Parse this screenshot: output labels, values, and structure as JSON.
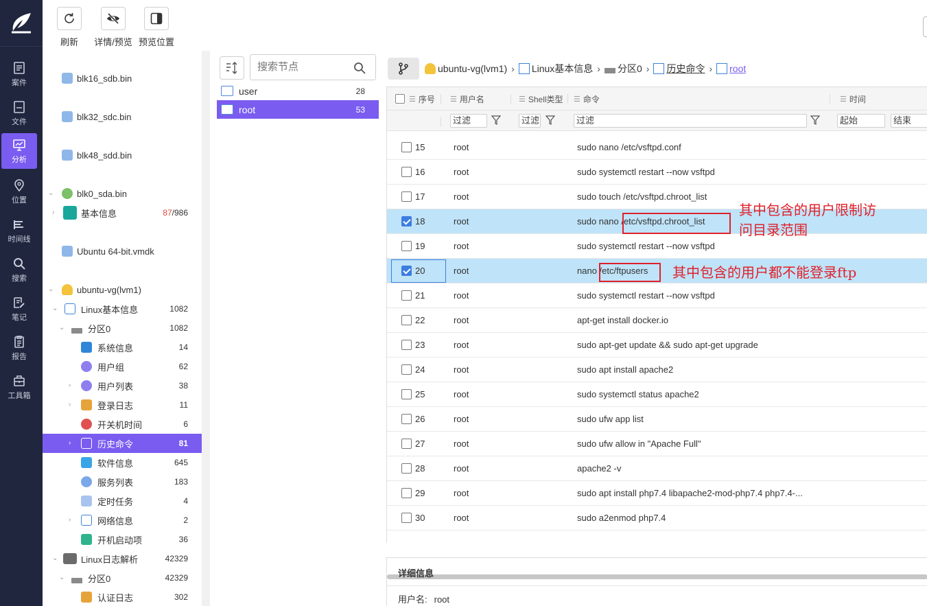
{
  "toolbar": {
    "refresh": "刷新",
    "detail_preview": "详情/预览",
    "preview_position": "预览位置"
  },
  "nav": {
    "items": [
      {
        "label": "案件",
        "icon": "case-icon"
      },
      {
        "label": "文件",
        "icon": "file-icon"
      },
      {
        "label": "分析",
        "icon": "analysis-icon",
        "active": true
      },
      {
        "label": "位置",
        "icon": "location-icon"
      },
      {
        "label": "时间线",
        "icon": "timeline-icon"
      },
      {
        "label": "搜索",
        "icon": "search-icon"
      },
      {
        "label": "笔记",
        "icon": "note-icon"
      },
      {
        "label": "报告",
        "icon": "report-icon"
      },
      {
        "label": "工具箱",
        "icon": "toolbox-icon"
      }
    ]
  },
  "tree": {
    "items": [
      {
        "label": "blk16_sdb.bin",
        "count": ""
      },
      {
        "label": "blk32_sdc.bin",
        "count": ""
      },
      {
        "label": "blk48_sdd.bin",
        "count": ""
      },
      {
        "label": "blk0_sda.bin",
        "count": ""
      },
      {
        "label": "基本信息",
        "count_red": "87",
        "count_rest": "/986"
      },
      {
        "label": "Ubuntu 64-bit.vmdk",
        "count": ""
      },
      {
        "label": "ubuntu-vg(lvm1)",
        "count": ""
      },
      {
        "label": "Linux基本信息",
        "count": "1082"
      },
      {
        "label": "分区0",
        "count": "1082"
      },
      {
        "label": "系统信息",
        "count": "14"
      },
      {
        "label": "用户组",
        "count": "62"
      },
      {
        "label": "用户列表",
        "count": "38"
      },
      {
        "label": "登录日志",
        "count": "11"
      },
      {
        "label": "开关机时间",
        "count": "6"
      },
      {
        "label": "历史命令",
        "count": "81"
      },
      {
        "label": "软件信息",
        "count": "645"
      },
      {
        "label": "服务列表",
        "count": "183"
      },
      {
        "label": "定时任务",
        "count": "4"
      },
      {
        "label": "网络信息",
        "count": "2"
      },
      {
        "label": "开机启动项",
        "count": "36"
      },
      {
        "label": "Linux日志解析",
        "count": "42329"
      },
      {
        "label": "分区0",
        "count": "42329"
      },
      {
        "label": "认证日志",
        "count": "302"
      }
    ]
  },
  "nodes": {
    "search_placeholder": "搜索节点",
    "items": [
      {
        "label": "user",
        "count": "28"
      },
      {
        "label": "root",
        "count": "53"
      }
    ]
  },
  "breadcrumb": {
    "items": [
      "ubuntu-vg(lvm1)",
      "Linux基本信息",
      "分区0",
      "历史命令",
      "root"
    ]
  },
  "table": {
    "headers": {
      "no": "序号",
      "user": "用户名",
      "shell": "Shell类型",
      "cmd": "命令",
      "time": "时间"
    },
    "filters": {
      "filter": "过滤",
      "start": "起始",
      "end": "结束"
    },
    "rows": [
      {
        "no": "15",
        "user": "root",
        "cmd": "sudo nano /etc/vsftpd.conf",
        "checked": false
      },
      {
        "no": "16",
        "user": "root",
        "cmd": "sudo systemctl restart --now vsftpd",
        "checked": false
      },
      {
        "no": "17",
        "user": "root",
        "cmd": "sudo touch /etc/vsftpd.chroot_list",
        "checked": false
      },
      {
        "no": "18",
        "user": "root",
        "cmd": "sudo nano /etc/vsftpd.chroot_list",
        "checked": true
      },
      {
        "no": "19",
        "user": "root",
        "cmd": "sudo systemctl restart --now vsftpd",
        "checked": false
      },
      {
        "no": "20",
        "user": "root",
        "cmd": "nano /etc/ftpusers",
        "checked": true
      },
      {
        "no": "21",
        "user": "root",
        "cmd": "sudo systemctl restart --now vsftpd",
        "checked": false
      },
      {
        "no": "22",
        "user": "root",
        "cmd": "apt-get install docker.io",
        "checked": false
      },
      {
        "no": "23",
        "user": "root",
        "cmd": "sudo apt-get update && sudo apt-get upgrade",
        "checked": false
      },
      {
        "no": "24",
        "user": "root",
        "cmd": "sudo apt install apache2",
        "checked": false
      },
      {
        "no": "25",
        "user": "root",
        "cmd": "sudo systemctl status apache2",
        "checked": false
      },
      {
        "no": "26",
        "user": "root",
        "cmd": "sudo ufw app list",
        "checked": false
      },
      {
        "no": "27",
        "user": "root",
        "cmd": "sudo ufw allow in \"Apache Full\"",
        "checked": false
      },
      {
        "no": "28",
        "user": "root",
        "cmd": "apache2 -v",
        "checked": false
      },
      {
        "no": "29",
        "user": "root",
        "cmd": "sudo apt install php7.4 libapache2-mod-php7.4 php7.4-...",
        "checked": false
      },
      {
        "no": "30",
        "user": "root",
        "cmd": "sudo a2enmod php7.4",
        "checked": false
      }
    ]
  },
  "annotations": {
    "note1_line1": "其中包含的用户限制访",
    "note1_line2": "问目录范围",
    "note2": "其中包含的用户都不能登录ftp"
  },
  "detail": {
    "title": "详细信息",
    "user_label": "用户名:",
    "user_value": "root"
  },
  "colors": {
    "nav_bg": "#20263d",
    "accent": "#7a5cf0",
    "row_highlight": "#bfe3f8",
    "annotation_red": "#e0202a"
  }
}
